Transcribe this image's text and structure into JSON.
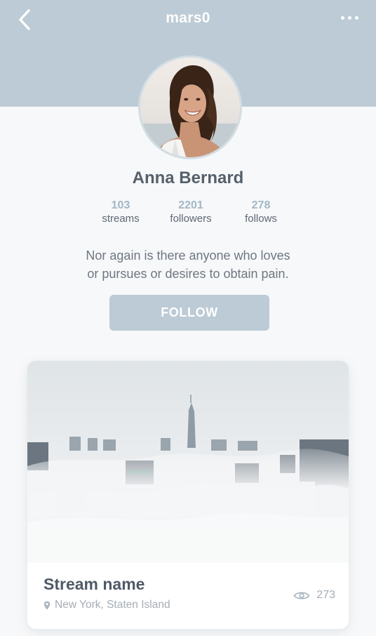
{
  "header": {
    "username": "mars0",
    "back_icon": "chevron-left-icon",
    "more_icon": "more-horizontal-icon"
  },
  "profile": {
    "name": "Anna Bernard",
    "stats": [
      {
        "value": "103",
        "label": "streams"
      },
      {
        "value": "2201",
        "label": "followers"
      },
      {
        "value": "278",
        "label": "follows"
      }
    ],
    "bio_line1": "Nor again is there anyone who loves",
    "bio_line2": "or pursues or desires to obtain pain.",
    "follow_label": "FOLLOW"
  },
  "stream_card": {
    "name": "Stream name",
    "location": "New York, Staten Island",
    "views": "273",
    "location_icon": "location-pin-icon",
    "views_icon": "eye-icon"
  },
  "colors": {
    "header_band": "#bccbd5",
    "accent": "#a2b7c6",
    "text_dark": "#4f5a66",
    "text_muted": "#a5adb5",
    "background": "#f7f8f9"
  }
}
